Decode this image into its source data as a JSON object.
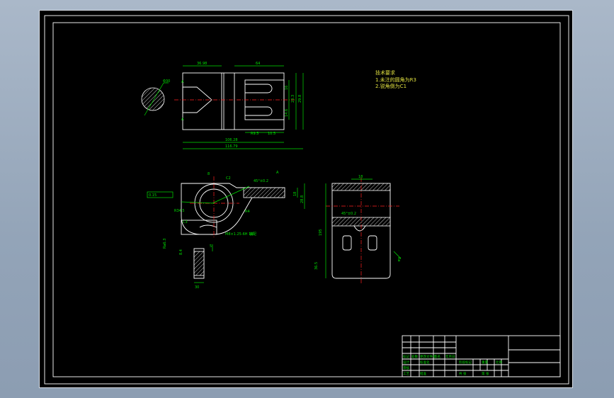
{
  "colors": {
    "background": "#000000",
    "outline": "#ffffff",
    "dimension": "#00e000",
    "centerline": "#ff2020",
    "note_text": "#e0e040"
  },
  "tech_notes": {
    "title": "技术要求",
    "line1": "1.未注的圆角为R3",
    "line2": "2.锐角倒为C1"
  },
  "view1": {
    "dims": {
      "top_left": "36.98",
      "top_right": "64",
      "right_inner": "16",
      "right_mid": "23.3",
      "right_outer": "29.8",
      "right_small": "14.6",
      "slot_a": "R9.5",
      "slot_b": "10.5",
      "total_inner": "106.28",
      "total_outer": "116.79"
    },
    "section_label": "A",
    "circle_dim": "Φ30"
  },
  "view2": {
    "dims": {
      "top_small": "8",
      "chamfer": "C2",
      "angle": "45°±0.2",
      "label_a": "A",
      "right_h": "18",
      "right_h2": "28.8",
      "left_tol": "0.15",
      "circle": "R34.5",
      "r_small": "R4",
      "r_c3": "C3",
      "thread": "M8×1.25-6H 10",
      "thread_note": "装配",
      "bottom": "30",
      "side": "8.4",
      "vert": "Ra6.3",
      "small_v": "5"
    }
  },
  "view3": {
    "dims": {
      "top": "18",
      "left_h": "195",
      "left_h2": "36.5",
      "section": "45°±0.2",
      "right_note": "Ra"
    }
  },
  "title_block": {
    "c1": "标记",
    "c2": "处数",
    "c3": "分区",
    "c4": "更改文件号",
    "c5": "签名",
    "c6": "年月日",
    "r_design": "设计",
    "r_std": "标准化",
    "r_check": "审核",
    "r_craft": "工艺",
    "r_approve": "批准",
    "stage": "阶段标记",
    "weight": "重量",
    "scale": "比例",
    "sheet": "共  张",
    "page": "第  张"
  }
}
